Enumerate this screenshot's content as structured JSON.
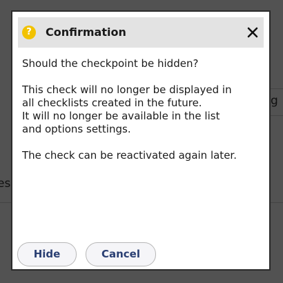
{
  "background": {
    "right_fragment": "g",
    "left_fragment": "es"
  },
  "dialog": {
    "title": "Confirmation",
    "title_icon": "help-icon",
    "close_icon": "close-icon",
    "question": "Should the checkpoint be hidden?",
    "info_line_1": "This check will no longer be displayed in",
    "info_line_2": "all checklists created in the future.",
    "info_line_3": "It will no longer be available in the list",
    "info_line_4": "and options settings.",
    "note": "The check can be reactivated again later.",
    "buttons": {
      "hide_label": "Hide",
      "cancel_label": "Cancel"
    }
  },
  "colors": {
    "help_icon": "#f2c200",
    "button_text": "#2a3f73",
    "header_bg": "#e3e3e3"
  }
}
